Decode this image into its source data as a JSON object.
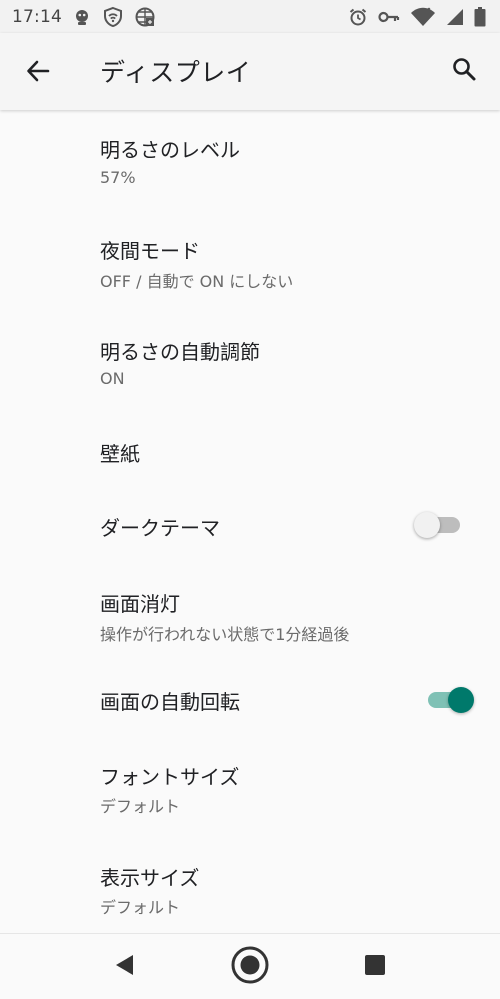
{
  "status_bar": {
    "time": "17:14",
    "left_icons": [
      "notification-icon",
      "wifi-shield-icon",
      "globe-grid-icon"
    ],
    "right_icons": [
      "alarm-icon",
      "vpn-key-icon",
      "wifi-icon",
      "signal-icon",
      "battery-icon"
    ]
  },
  "app_bar": {
    "title": "ディスプレイ",
    "back_icon": "arrow-back-icon",
    "search_icon": "search-icon"
  },
  "settings": {
    "items": [
      {
        "title": "明るさのレベル",
        "subtitle": "57%"
      },
      {
        "title": "夜間モード",
        "subtitle": "OFF / 自動で ON にしない"
      },
      {
        "title": "明るさの自動調節",
        "subtitle": "ON"
      },
      {
        "title": "壁紙",
        "subtitle": ""
      },
      {
        "title": "ダークテーマ",
        "subtitle": "",
        "switch": false
      },
      {
        "title": "画面消灯",
        "subtitle": "操作が行われない状態で1分経過後"
      },
      {
        "title": "画面の自動回転",
        "subtitle": "",
        "switch": true
      },
      {
        "title": "フォントサイズ",
        "subtitle": "デフォルト"
      },
      {
        "title": "表示サイズ",
        "subtitle": "デフォルト"
      }
    ]
  },
  "colors": {
    "accent": "#00796b",
    "accent_track": "#7fc1b5",
    "background": "#fafafa",
    "text_primary": "#202124",
    "text_secondary": "#6b6b6b"
  },
  "nav_bar": {
    "back_icon": "nav-back-icon",
    "home_icon": "nav-home-icon",
    "recents_icon": "nav-recents-icon"
  }
}
